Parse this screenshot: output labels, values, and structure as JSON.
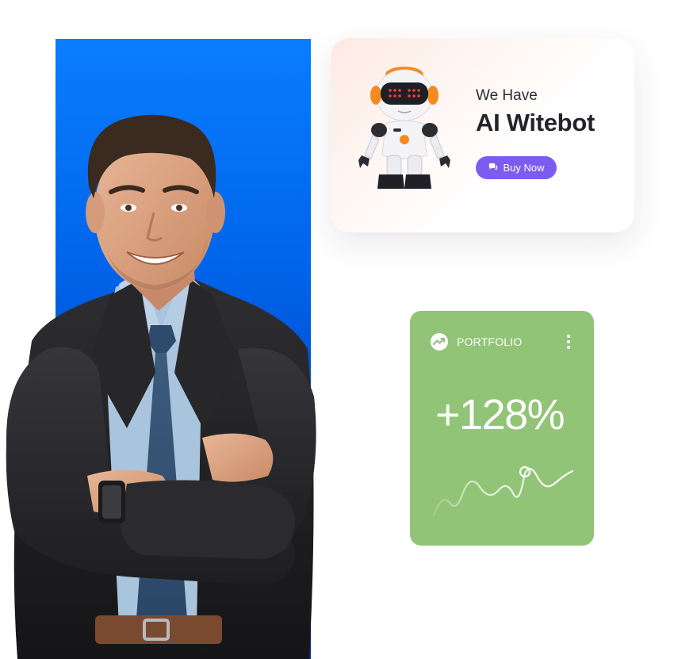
{
  "promo": {
    "eyebrow": "We Have",
    "title": "AI Witebot",
    "button_label": "Buy Now",
    "button_icon": "chat-bubble-icon",
    "accent_color": "#7c5cf0"
  },
  "portfolio": {
    "label": "PORTFOLIO",
    "icon": "trend-up-icon",
    "menu_icon": "more-vertical-icon",
    "value": "+128%",
    "background_color": "#91c476"
  },
  "backdrop": {
    "color_top": "#0a7dff",
    "color_bottom": "#0230a8"
  }
}
